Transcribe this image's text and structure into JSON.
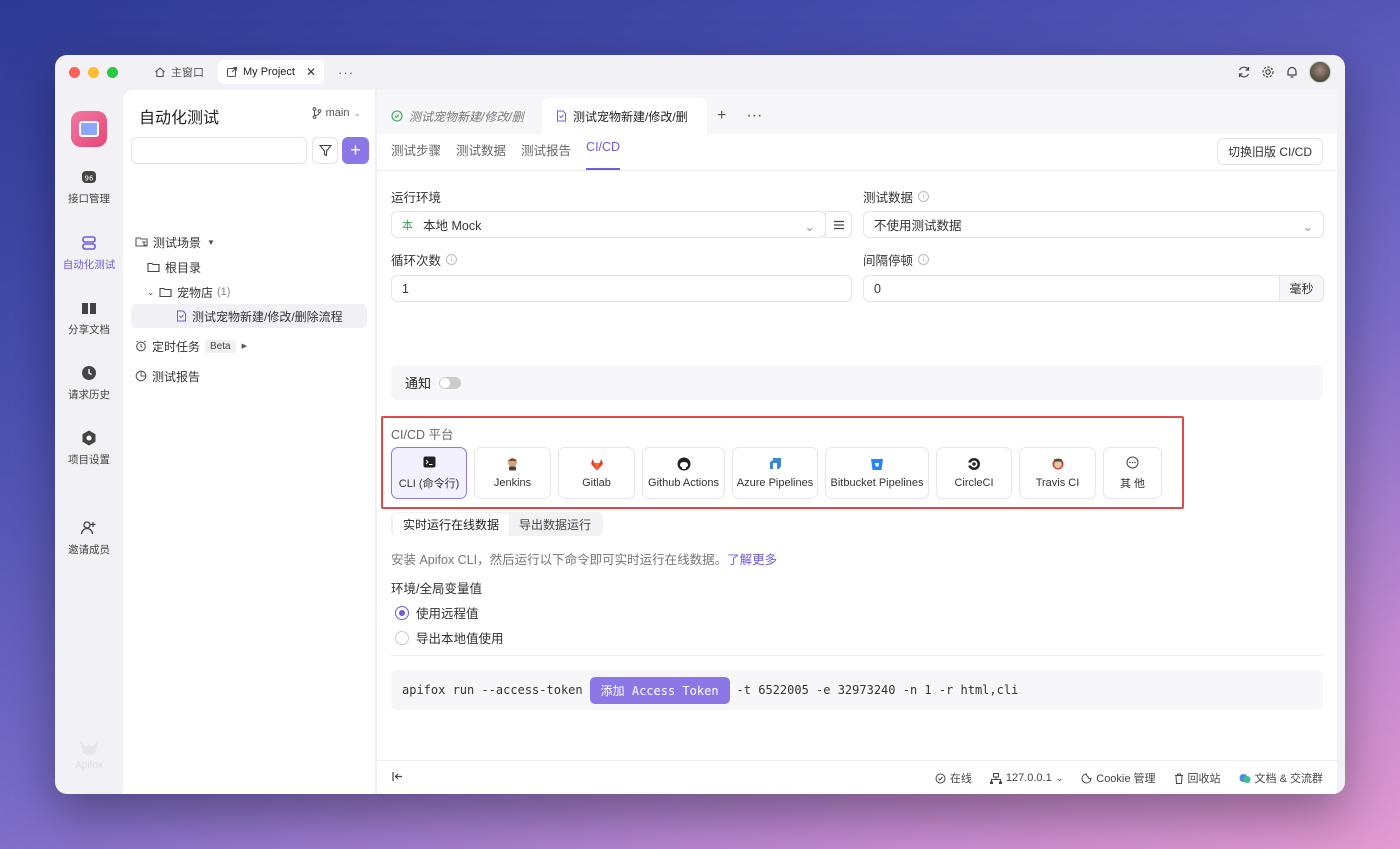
{
  "titlebar": {
    "tabs": [
      {
        "label": "主窗口",
        "icon": "home-icon"
      },
      {
        "label": "My Project",
        "icon": "external-icon"
      }
    ],
    "more": "···"
  },
  "leftnav": {
    "items": [
      {
        "label": "接口管理",
        "icon": "api-icon"
      },
      {
        "label": "自动化测试",
        "icon": "automation-icon"
      },
      {
        "label": "分享文档",
        "icon": "book-icon"
      },
      {
        "label": "请求历史",
        "icon": "clock-icon"
      },
      {
        "label": "项目设置",
        "icon": "settings-hex-icon"
      },
      {
        "label": "邀请成员",
        "icon": "add-user-icon"
      }
    ],
    "brand": "Apifox"
  },
  "sidebar": {
    "title": "自动化测试",
    "branch": "main",
    "search_placeholder": "",
    "tree": {
      "scenes": "测试场景",
      "root": "根目录",
      "folder": "宠物店",
      "folder_count": "(1)",
      "case": "测试宠物新建/修改/删除流程",
      "scheduled": "定时任务",
      "beta": "Beta",
      "reports": "测试报告"
    }
  },
  "main": {
    "doc_tabs": [
      {
        "label": "测试宠物新建/修改/删"
      },
      {
        "label": "测试宠物新建/修改/删"
      }
    ],
    "sub_tabs": [
      "测试步骤",
      "测试数据",
      "测试报告",
      "CI/CD"
    ],
    "legacy_button": "切换旧版 CI/CD",
    "run_env_label": "运行环境",
    "run_env_value": "本地 Mock",
    "test_data_label": "测试数据",
    "test_data_value": "不使用测试数据",
    "loop_label": "循环次数",
    "loop_value": "1",
    "interval_label": "间隔停顿",
    "interval_value": "0",
    "interval_unit": "毫秒",
    "notify_label": "通知",
    "cicd_title": "CI/CD 平台",
    "platforms": [
      {
        "label": "CLI (命令行)",
        "icon": "terminal-icon"
      },
      {
        "label": "Jenkins",
        "icon": "jenkins-icon"
      },
      {
        "label": "Gitlab",
        "icon": "gitlab-icon"
      },
      {
        "label": "Github Actions",
        "icon": "github-icon"
      },
      {
        "label": "Azure Pipelines",
        "icon": "azure-icon"
      },
      {
        "label": "Bitbucket Pipelines",
        "icon": "bitbucket-icon"
      },
      {
        "label": "CircleCI",
        "icon": "circleci-icon"
      },
      {
        "label": "Travis CI",
        "icon": "travis-icon"
      },
      {
        "label": "其 他",
        "icon": "more-icon"
      }
    ],
    "run_modes": [
      "实时运行在线数据",
      "导出数据运行"
    ],
    "hint_text": "安装 Apifox CLI，然后运行以下命令即可实时运行在线数据。",
    "hint_link": "了解更多",
    "env_values_label": "环境/全局变量值",
    "radio_options": [
      "使用远程值",
      "导出本地值使用"
    ],
    "cmd_prefix": "apifox run --access-token",
    "token_button": "添加 Access Token",
    "cmd_suffix": "-t 6522005 -e 32973240 -n 1 -r html,cli"
  },
  "statusbar": {
    "online": "在线",
    "host": "127.0.0.1",
    "cookie": "Cookie 管理",
    "recycle": "回收站",
    "docs": "文档 & 交流群"
  },
  "colors": {
    "accent": "#6d5ce0",
    "highlight": "#e04a4a"
  }
}
